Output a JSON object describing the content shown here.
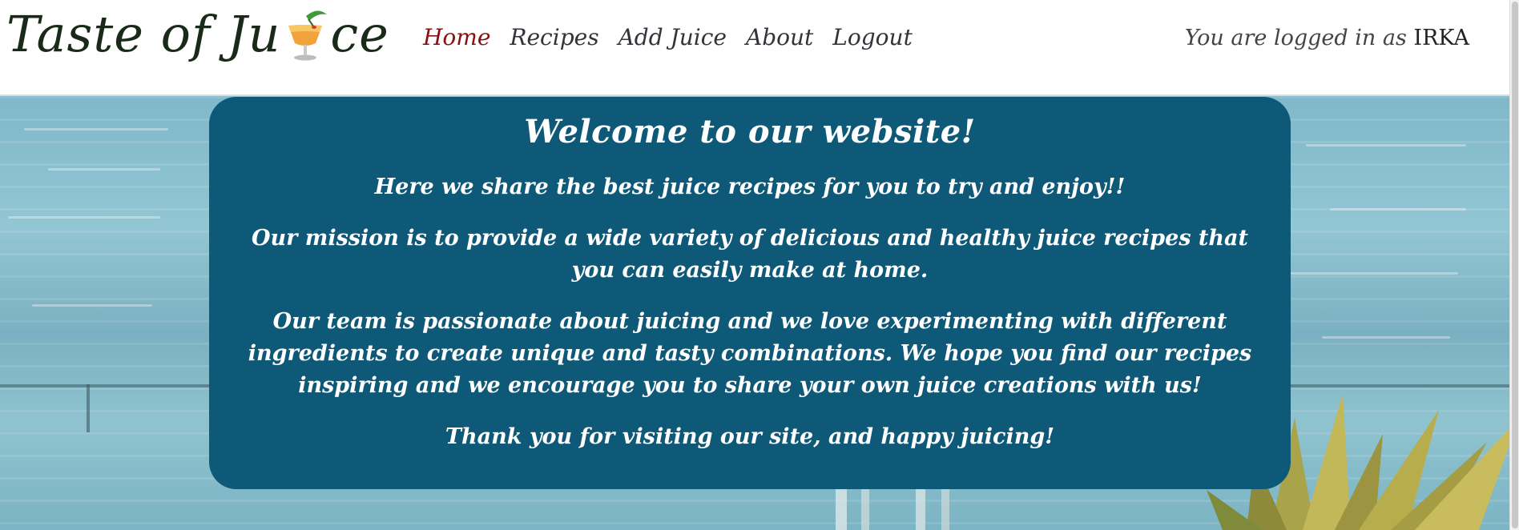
{
  "brand": {
    "title_left": "Taste of Ju",
    "title_right": "ce",
    "glass_icon": "tropical-drink-icon"
  },
  "nav": {
    "items": [
      {
        "label": "Home",
        "active": true
      },
      {
        "label": "Recipes",
        "active": false
      },
      {
        "label": "Add Juice",
        "active": false
      },
      {
        "label": "About",
        "active": false
      },
      {
        "label": "Logout",
        "active": false
      }
    ]
  },
  "user": {
    "prefix": "You are logged in as",
    "name": "IRKA"
  },
  "welcome": {
    "title": "Welcome to our website!",
    "p1": "Here we share the best juice recipes for you to try and enjoy!!",
    "p2": "Our mission is to provide a wide variety of delicious and healthy juice recipes that you can easily make at home.",
    "p3": "Our team is passionate about juicing and we love experimenting with different ingredients to create unique and tasty combinations. We hope you find our recipes inspiring and we encourage you to share your own juice creations with us!",
    "p4": "Thank you for visiting our site, and happy juicing!"
  },
  "colors": {
    "card": "#0e5878",
    "active_nav": "#8a1010",
    "nav": "#33333b"
  }
}
